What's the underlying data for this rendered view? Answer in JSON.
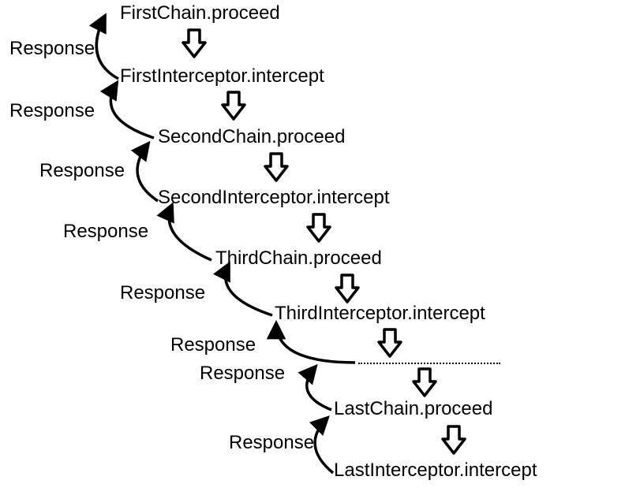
{
  "nodes": [
    {
      "id": "first-chain-proceed",
      "label": "FirstChain.proceed"
    },
    {
      "id": "first-interceptor-intercept",
      "label": "FirstInterceptor.intercept"
    },
    {
      "id": "second-chain-proceed",
      "label": "SecondChain.proceed"
    },
    {
      "id": "second-interceptor-intercept",
      "label": "SecondInterceptor.intercept"
    },
    {
      "id": "third-chain-proceed",
      "label": "ThirdChain.proceed"
    },
    {
      "id": "third-interceptor-intercept",
      "label": "ThirdInterceptor.intercept"
    },
    {
      "id": "last-chain-proceed",
      "label": "LastChain.proceed"
    },
    {
      "id": "last-interceptor-intercept",
      "label": "LastInterceptor.intercept"
    }
  ],
  "responses": [
    {
      "id": "response-1",
      "label": "Response"
    },
    {
      "id": "response-2",
      "label": "Response"
    },
    {
      "id": "response-3",
      "label": "Response"
    },
    {
      "id": "response-4",
      "label": "Response"
    },
    {
      "id": "response-5",
      "label": "Response"
    },
    {
      "id": "response-6",
      "label": "Response"
    },
    {
      "id": "response-7",
      "label": "Response"
    },
    {
      "id": "response-8",
      "label": "Response"
    }
  ]
}
